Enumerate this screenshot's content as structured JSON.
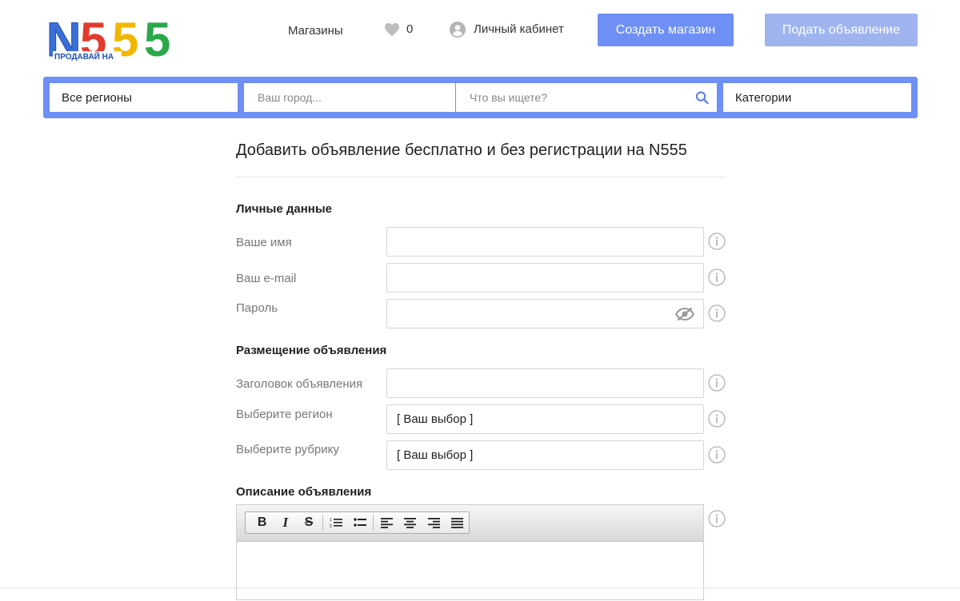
{
  "brand": {
    "logo_text": "N555",
    "logo_tagline": "ПРОДАВАЙ НА",
    "colors": {
      "accent": "#6e8ff5",
      "accent_light": "#9fb4ef",
      "logo_blue": "#3a6fd8",
      "logo_red": "#e23b2e",
      "logo_yellow": "#f2b705",
      "logo_green": "#2aa84a"
    }
  },
  "header": {
    "stores_label": "Магазины",
    "favorites_count": "0",
    "favorites_icon": "heart-icon",
    "cabinet_label": "Личный кабинет",
    "cabinet_icon": "user-circle-icon",
    "create_store_label": "Создать магазин",
    "post_ad_label": "Подать объявление"
  },
  "search": {
    "region_label": "Все регионы",
    "city_placeholder": "Ваш город...",
    "query_placeholder": "Что вы ищете?",
    "search_icon": "search-icon",
    "categories_label": "Категории"
  },
  "form": {
    "title": "Добавить объявление бесплатно и без регистрации на N555",
    "personal_section": "Личные данные",
    "name_label": "Ваше имя",
    "email_label": "Ваш e-mail",
    "password_label": "Пароль",
    "placement_section": "Размещение объявления",
    "ad_title_label": "Заголовок объявления",
    "region_label": "Выберите регион",
    "region_value": "[ Ваш выбор ]",
    "rubric_label": "Выберите рубрику",
    "rubric_value": "[ Ваш выбор ]",
    "description_section": "Описание объявления",
    "toolbar": {
      "bold": "B",
      "italic": "I",
      "strike": "S"
    }
  }
}
